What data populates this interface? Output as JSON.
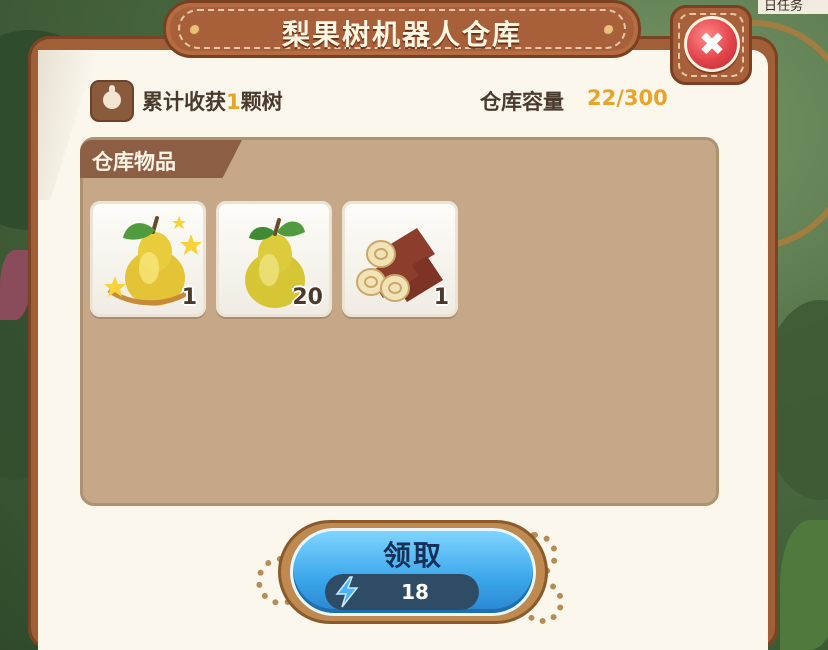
{
  "window": {
    "title": "梨果树机器人仓库",
    "corner_text": "日任务"
  },
  "info": {
    "harvest_prefix": "累计收获",
    "harvest_count": "1",
    "harvest_suffix": "颗树",
    "capacity_label": "仓库容量",
    "capacity_value": "22/300"
  },
  "storage": {
    "tab_label": "仓库物品",
    "items": [
      {
        "name": "golden-pear",
        "icon": "golden-pear-icon",
        "count": "1"
      },
      {
        "name": "pear",
        "icon": "pear-icon",
        "count": "20"
      },
      {
        "name": "wood-logs",
        "icon": "wood-logs-icon",
        "count": "1"
      }
    ]
  },
  "claim": {
    "label": "领取",
    "energy_icon": "lightning-icon",
    "energy_cost": "18"
  },
  "colors": {
    "panel_brown": "#a05f37",
    "storage_tan": "#c6a788",
    "accent_gold": "#e7a42a",
    "claim_blue": "#3aa6ea",
    "close_red": "#e3434a"
  }
}
